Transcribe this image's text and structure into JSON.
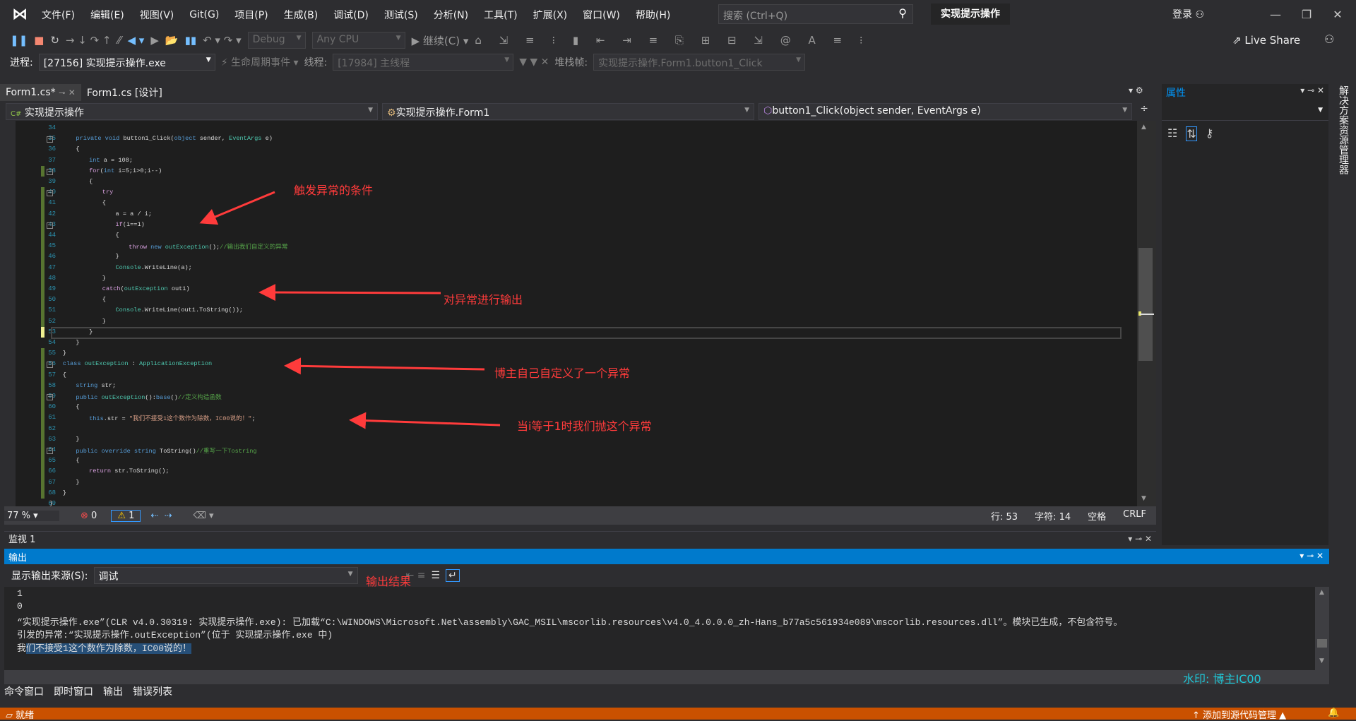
{
  "titlebar": {
    "logo": "VS",
    "menus": [
      "文件(F)",
      "编辑(E)",
      "视图(V)",
      "Git(G)",
      "项目(P)",
      "生成(B)",
      "调试(D)",
      "测试(S)",
      "分析(N)",
      "工具(T)",
      "扩展(X)",
      "窗口(W)",
      "帮助(H)"
    ],
    "search_placeholder": "搜索 (Ctrl+Q)",
    "solution": "实现提示操作",
    "login": "登录"
  },
  "toolbar": {
    "config": "Debug",
    "platform": "Any CPU",
    "continue": "继续(C)",
    "live_share": "Live Share"
  },
  "debugbar": {
    "process_label": "进程:",
    "process": "[27156] 实现提示操作.exe",
    "lifecycle": "生命周期事件",
    "thread_label": "线程:",
    "thread": "[17984] 主线程",
    "stack_label": "堆栈帧:",
    "stack": "实现提示操作.Form1.button1_Click"
  },
  "tabs": [
    {
      "label": "Form1.cs*",
      "active": true
    },
    {
      "label": "Form1.cs [设计]",
      "active": false
    }
  ],
  "nav": {
    "project": "实现提示操作",
    "class": "实现提示操作.Form1",
    "member": "button1_Click(object sender, EventArgs e)"
  },
  "code": [
    {
      "n": 34,
      "i": 0,
      "s": []
    },
    {
      "n": 35,
      "i": 2,
      "s": [
        [
          "kw",
          "private "
        ],
        [
          "kw",
          "void "
        ],
        [
          "tx",
          "button1_Click("
        ],
        [
          "kw",
          "object "
        ],
        [
          "tx",
          "sender, "
        ],
        [
          "ty",
          "EventArgs "
        ],
        [
          "tx",
          "e)"
        ]
      ]
    },
    {
      "n": 36,
      "i": 2,
      "s": [
        [
          "tx",
          "{"
        ]
      ]
    },
    {
      "n": 37,
      "i": 3,
      "s": [
        [
          "kw",
          "int "
        ],
        [
          "tx",
          "a = 108;"
        ]
      ]
    },
    {
      "n": 38,
      "i": 3,
      "s": [
        [
          "ct",
          "for"
        ],
        [
          "tx",
          "("
        ],
        [
          "kw",
          "int "
        ],
        [
          "tx",
          "i=5;i>0;i--)"
        ]
      ]
    },
    {
      "n": 39,
      "i": 3,
      "s": [
        [
          "tx",
          "{"
        ]
      ]
    },
    {
      "n": 40,
      "i": 4,
      "s": [
        [
          "ct",
          "try"
        ]
      ]
    },
    {
      "n": 41,
      "i": 4,
      "s": [
        [
          "tx",
          "{"
        ]
      ]
    },
    {
      "n": 42,
      "i": 5,
      "s": [
        [
          "tx",
          "a = a / i;"
        ]
      ]
    },
    {
      "n": 43,
      "i": 5,
      "s": [
        [
          "ct",
          "if"
        ],
        [
          "tx",
          "(i==1)"
        ]
      ]
    },
    {
      "n": 44,
      "i": 5,
      "s": [
        [
          "tx",
          "{"
        ]
      ]
    },
    {
      "n": 45,
      "i": 6,
      "s": [
        [
          "ct",
          "throw "
        ],
        [
          "kw",
          "new "
        ],
        [
          "ty",
          "outException"
        ],
        [
          "tx",
          "();"
        ],
        [
          "cm",
          "//输出我们自定义的异常"
        ]
      ]
    },
    {
      "n": 46,
      "i": 5,
      "s": [
        [
          "tx",
          "}"
        ]
      ]
    },
    {
      "n": 47,
      "i": 5,
      "s": [
        [
          "ty",
          "Console"
        ],
        [
          "tx",
          ".WriteLine(a);"
        ]
      ]
    },
    {
      "n": 48,
      "i": 4,
      "s": [
        [
          "tx",
          "}"
        ]
      ]
    },
    {
      "n": 49,
      "i": 4,
      "s": [
        [
          "ct",
          "catch"
        ],
        [
          "tx",
          "("
        ],
        [
          "ty",
          "outException"
        ],
        [
          "tx",
          " out1)"
        ]
      ]
    },
    {
      "n": 50,
      "i": 4,
      "s": [
        [
          "tx",
          "{"
        ]
      ]
    },
    {
      "n": 51,
      "i": 5,
      "s": [
        [
          "ty",
          "Console"
        ],
        [
          "tx",
          ".WriteLine(out1.ToString());"
        ]
      ]
    },
    {
      "n": 52,
      "i": 4,
      "s": [
        [
          "tx",
          "}"
        ]
      ]
    },
    {
      "n": 53,
      "i": 3,
      "s": [
        [
          "tx",
          "}"
        ]
      ]
    },
    {
      "n": 54,
      "i": 2,
      "s": [
        [
          "tx",
          "}"
        ]
      ]
    },
    {
      "n": 55,
      "i": 1,
      "s": [
        [
          "tx",
          "}"
        ]
      ]
    },
    {
      "n": 56,
      "i": 1,
      "s": [
        [
          "kw",
          "class "
        ],
        [
          "ty",
          "outException"
        ],
        [
          "tx",
          " : "
        ],
        [
          "ty",
          "ApplicationException"
        ]
      ]
    },
    {
      "n": 57,
      "i": 1,
      "s": [
        [
          "tx",
          "{"
        ]
      ]
    },
    {
      "n": 58,
      "i": 2,
      "s": [
        [
          "kw",
          "string "
        ],
        [
          "tx",
          "str;"
        ]
      ]
    },
    {
      "n": 59,
      "i": 2,
      "s": [
        [
          "kw",
          "public "
        ],
        [
          "ty",
          "outException"
        ],
        [
          "tx",
          "():"
        ],
        [
          "kw",
          "base"
        ],
        [
          "tx",
          "()"
        ],
        [
          "cm",
          "//定义构造函数"
        ]
      ]
    },
    {
      "n": 60,
      "i": 2,
      "s": [
        [
          "tx",
          "{"
        ]
      ]
    },
    {
      "n": 61,
      "i": 3,
      "s": [
        [
          "kw",
          "this"
        ],
        [
          "tx",
          ".str = "
        ],
        [
          "st",
          "\"我们不接受1这个数作为除数，IC00说的！\""
        ],
        [
          "tx",
          ";"
        ]
      ]
    },
    {
      "n": 62,
      "i": 0,
      "s": []
    },
    {
      "n": 63,
      "i": 2,
      "s": [
        [
          "tx",
          "}"
        ]
      ]
    },
    {
      "n": 64,
      "i": 2,
      "s": [
        [
          "kw",
          "public "
        ],
        [
          "kw",
          "override "
        ],
        [
          "kw",
          "string "
        ],
        [
          "tx",
          "ToString()"
        ],
        [
          "cm",
          "//重写一下Tostring"
        ]
      ]
    },
    {
      "n": 65,
      "i": 2,
      "s": [
        [
          "tx",
          "{"
        ]
      ]
    },
    {
      "n": 66,
      "i": 3,
      "s": [
        [
          "ct",
          "return "
        ],
        [
          "tx",
          "str.ToString();"
        ]
      ]
    },
    {
      "n": 67,
      "i": 2,
      "s": [
        [
          "tx",
          "}"
        ]
      ]
    },
    {
      "n": 68,
      "i": 1,
      "s": [
        [
          "tx",
          "}"
        ]
      ]
    },
    {
      "n": 69,
      "i": 0,
      "s": [
        [
          "tx",
          "}"
        ]
      ]
    }
  ],
  "annotations": [
    "触发异常的条件",
    "对异常进行输出",
    "博主自己自定义了一个异常",
    "当i等于1时我们抛这个异常",
    "输出结果"
  ],
  "editor_status": {
    "zoom": "77 %",
    "errors": "0",
    "warnings": "1",
    "line": "行: 53",
    "char": "字符: 14",
    "spaces": "空格",
    "eol": "CRLF"
  },
  "watch": {
    "title": "监视 1"
  },
  "output": {
    "title": "输出",
    "source_label": "显示输出来源(S):",
    "source": "调试",
    "lines": [
      "1",
      "0",
      "“实现提示操作.exe”(CLR v4.0.30319: 实现提示操作.exe): 已加载“C:\\WINDOWS\\Microsoft.Net\\assembly\\GAC_MSIL\\mscorlib.resources\\v4.0_4.0.0.0_zh-Hans_b77a5c561934e089\\mscorlib.resources.dll”。模块已生成，不包含符号。",
      "引发的异常:“实现提示操作.outException”(位于 实现提示操作.exe 中)"
    ],
    "last_prefix": "我",
    "last_selected": "们不接受1这个数作为除数，IC00说的！"
  },
  "watermark": "水印: 博主IC00",
  "bottom_tabs": [
    "命令窗口",
    "即时窗口",
    "输出",
    "错误列表"
  ],
  "statusbar": {
    "ready": "就绪",
    "source_control": "添加到源代码管理"
  },
  "properties": {
    "title": "属性"
  },
  "side_tab": "解决方案资源管理器",
  "colors": {
    "accent": "#007acc",
    "status": "#ca5100",
    "annotation": "#ff3b3b",
    "watermark": "#1fc8d8"
  }
}
